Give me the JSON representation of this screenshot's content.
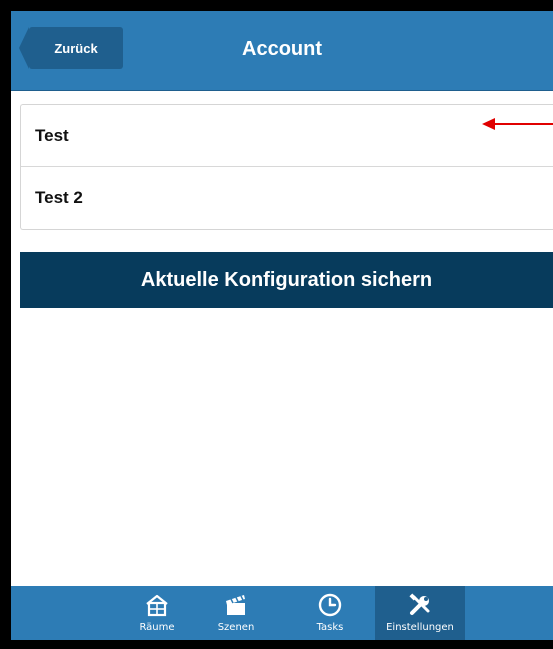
{
  "header": {
    "back_label": "Zurück",
    "title": "Account"
  },
  "list": {
    "items": [
      {
        "label": "Test"
      },
      {
        "label": "Test 2"
      }
    ]
  },
  "actions": {
    "save_config_label": "Aktuelle Konfiguration sichern"
  },
  "tabbar": {
    "tabs": [
      {
        "label": "Räume",
        "icon": "house-icon",
        "active": false
      },
      {
        "label": "Szenen",
        "icon": "clapperboard-icon",
        "active": false
      },
      {
        "label": "Tasks",
        "icon": "clock-icon",
        "active": false
      },
      {
        "label": "Einstellungen",
        "icon": "tools-icon",
        "active": true
      }
    ]
  },
  "colors": {
    "header_blue": "#2d7cb5",
    "dark_button": "#073b5c",
    "active_tab": "#1f5f8e",
    "annotation_arrow": "#e00000"
  }
}
